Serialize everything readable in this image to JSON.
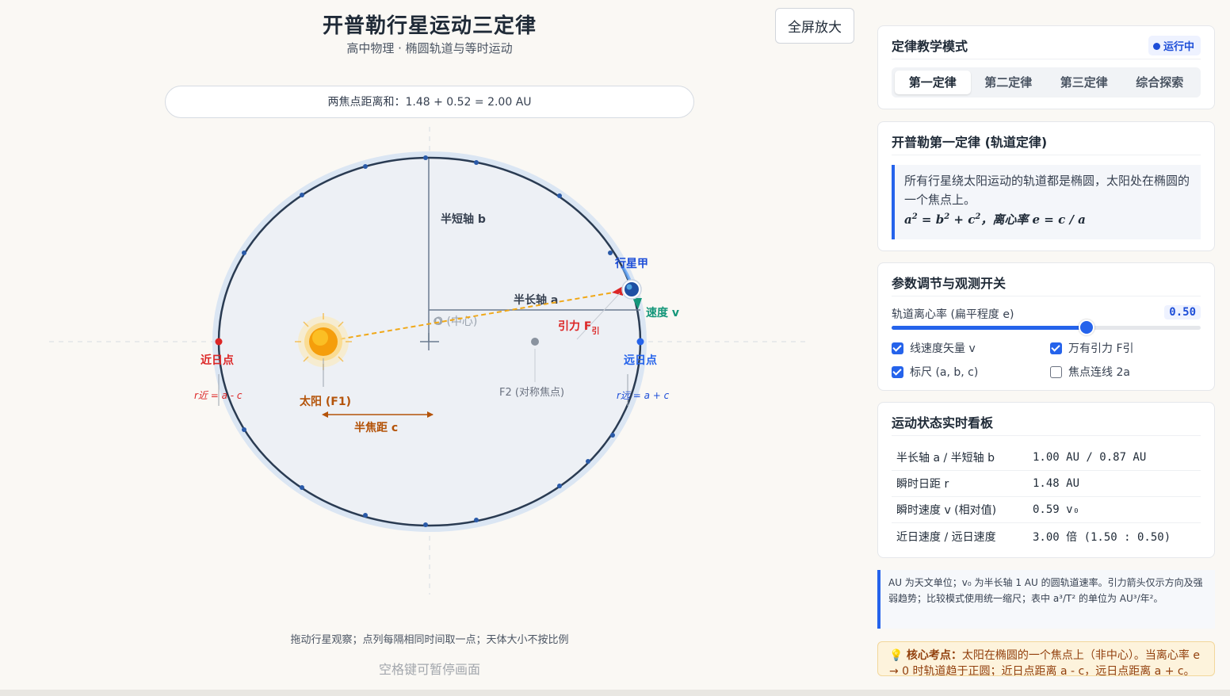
{
  "header": {
    "title": "开普勒行星运动三定律",
    "subtitle": "高中物理 · 椭圆轨道与等时运动",
    "fullscreen_label": "全屏放大",
    "focus_sum": "两焦点距离和：1.48 + 0.52 = 2.00 AU"
  },
  "diagram": {
    "semi_minor_label": "半短轴 b",
    "semi_major_label": "半长轴 a",
    "center_label": "O (中心)",
    "planet_label": "行星甲",
    "velocity_label": "速度 v",
    "force_label": "引力 F",
    "force_sub": "引",
    "perihelion_label": "近日点",
    "aphelion_label": "远日点",
    "r_near_label": "r近 = a - c",
    "r_far_label": "r远 = a + c",
    "sun_label": "太阳 (F1)",
    "f2_label": "F2 (对称焦点)",
    "focal_label": "半焦距 c",
    "colors": {
      "orbit": "#2a3b52",
      "sun": "#f59e0b",
      "planet": "#2563eb",
      "velocity": "#15977a",
      "force": "#dc2626",
      "perihelion": "#dc2626",
      "aphelion": "#2563eb",
      "focal": "#b45309"
    }
  },
  "footer": {
    "hint": "拖动行星观察；点列每隔相同时间取一点；天体大小不按比例",
    "pause_hint": "空格键可暂停画面"
  },
  "mode_card": {
    "title": "定律教学模式",
    "status": "运行中",
    "tabs": [
      "第一定律",
      "第二定律",
      "第三定律",
      "综合探索"
    ],
    "active_tab": 0
  },
  "law_card": {
    "title": "开普勒第一定律 (轨道定律)",
    "text": "所有行星绕太阳运动的轨道都是椭圆，太阳处在椭圆的一个焦点上。",
    "formula_a": "a",
    "formula_rest": " = b",
    "formula_mid": " + c",
    "formula_tail": "，离心率 e = c / a",
    "exp": "2"
  },
  "params_card": {
    "title": "参数调节与观测开关",
    "slider_label": "轨道离心率 (扁平程度 e)",
    "slider_value": "0.50",
    "slider_fraction": 0.63,
    "checks": [
      {
        "label": "线速度矢量 v",
        "checked": true
      },
      {
        "label": "万有引力 F引",
        "checked": true
      },
      {
        "label": "标尺 (a, b, c)",
        "checked": true
      },
      {
        "label": "焦点连线 2a",
        "checked": false
      }
    ]
  },
  "dashboard": {
    "title": "运动状态实时看板",
    "rows": [
      {
        "key": "半长轴 a / 半短轴 b",
        "value": "1.00 AU / 0.87 AU"
      },
      {
        "key": "瞬时日距 r",
        "value": "1.48 AU"
      },
      {
        "key": "瞬时速度 v (相对值)",
        "value": "0.59 v₀"
      },
      {
        "key": "近日速度 / 远日速度",
        "value": "3.00 倍 (1.50 : 0.50)"
      }
    ]
  },
  "note": "AU 为天文单位；v₀ 为半长轴 1 AU 的圆轨道速率。引力箭头仅示方向及强弱趋势；比较模式使用统一缩尺；表中 a³/T² 的单位为 AU³/年²。",
  "tip": {
    "label": "核心考点：",
    "text": "太阳在椭圆的一个焦点上（非中心）。当离心率 e → 0 时轨道趋于正圆；近日点距离 a - c，远日点距离 a + c。"
  }
}
